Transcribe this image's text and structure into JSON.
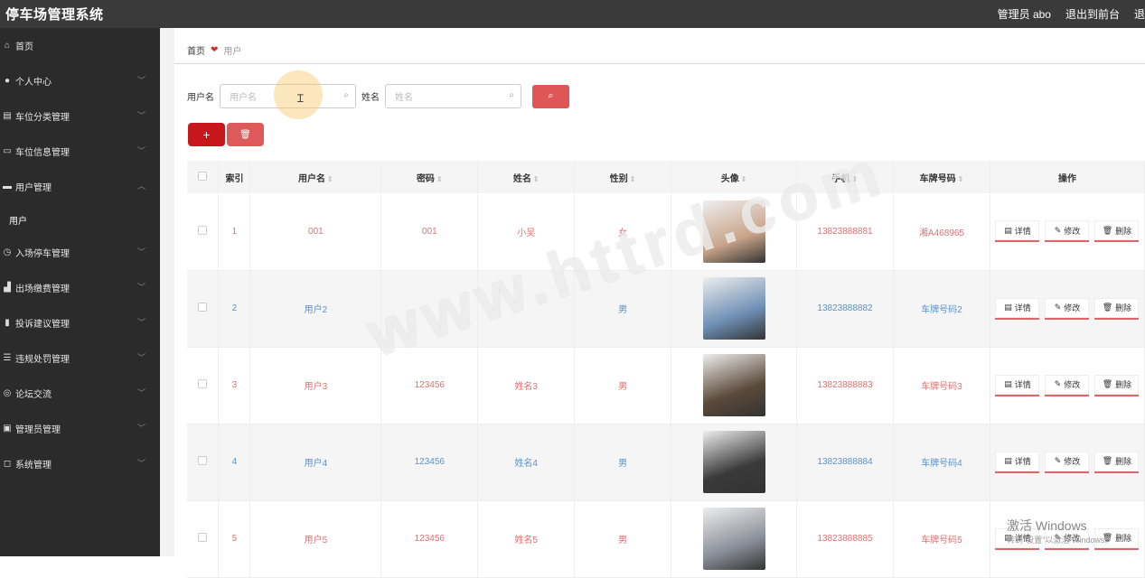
{
  "header": {
    "title": "停车场管理系统",
    "admin": "管理员 abo",
    "to_front": "退出到前台",
    "logout": "退出登"
  },
  "sidebar": {
    "items": [
      {
        "label": "首页",
        "icon": "home-icon",
        "glyph": "⌂"
      },
      {
        "label": "个人中心",
        "icon": "user-icon",
        "glyph": "●"
      },
      {
        "label": "车位分类管理",
        "icon": "list-icon",
        "glyph": "▤"
      },
      {
        "label": "车位信息管理",
        "icon": "card-icon",
        "glyph": "▭"
      },
      {
        "label": "用户管理",
        "icon": "users-icon",
        "glyph": "▬"
      },
      {
        "label": "入场停车管理",
        "icon": "clock-icon",
        "glyph": "◷"
      },
      {
        "label": "出场缴费管理",
        "icon": "chart-icon",
        "glyph": "▟"
      },
      {
        "label": "投诉建议管理",
        "icon": "bar-icon",
        "glyph": "▮"
      },
      {
        "label": "违规处罚管理",
        "icon": "sliders-icon",
        "glyph": "☰"
      },
      {
        "label": "论坛交流",
        "icon": "compass-icon",
        "glyph": "◎"
      },
      {
        "label": "管理员管理",
        "icon": "card2-icon",
        "glyph": "▣"
      },
      {
        "label": "系统管理",
        "icon": "box-icon",
        "glyph": "◻"
      }
    ],
    "sub_user": "用户"
  },
  "breadcrumb": {
    "home": "首页",
    "current": "用户"
  },
  "search": {
    "username_label": "用户名",
    "username_placeholder": "用户名",
    "name_label": "姓名",
    "name_placeholder": "姓名"
  },
  "table": {
    "headers": [
      "索引",
      "用户名",
      "密码",
      "姓名",
      "性别",
      "头像",
      "手机",
      "车牌号码",
      "操作"
    ],
    "rows": [
      {
        "idx": "1",
        "username": "001",
        "password": "001",
        "name": "小吴",
        "gender": "女",
        "phone": "13823888881",
        "plate": "湘A468965",
        "avatar_color": "#c9a58a"
      },
      {
        "idx": "2",
        "username": "用户2",
        "password": "",
        "name": "",
        "gender": "男",
        "phone": "13823888882",
        "plate": "车牌号码2",
        "avatar_color": "#6f8fb5"
      },
      {
        "idx": "3",
        "username": "用户3",
        "password": "123456",
        "name": "姓名3",
        "gender": "男",
        "phone": "13823888883",
        "plate": "车牌号码3",
        "avatar_color": "#5a4a3a"
      },
      {
        "idx": "4",
        "username": "用户4",
        "password": "123456",
        "name": "姓名4",
        "gender": "男",
        "phone": "13823888884",
        "plate": "车牌号码4",
        "avatar_color": "#3a3a3a"
      },
      {
        "idx": "5",
        "username": "用户5",
        "password": "123456",
        "name": "姓名5",
        "gender": "男",
        "phone": "13823888885",
        "plate": "车牌号码5",
        "avatar_color": "#8a8f99"
      }
    ],
    "actions": {
      "detail": "详情",
      "edit": "修改",
      "delete": "删除"
    }
  },
  "watermark": "www.httrd.com",
  "windows": {
    "activate": "激活 Windows",
    "hint": "转到\"设置\"以激活 Windows。"
  },
  "colors": {
    "accent": "#c8161d",
    "odd_text": "#e07070",
    "even_text": "#5b92c9"
  }
}
